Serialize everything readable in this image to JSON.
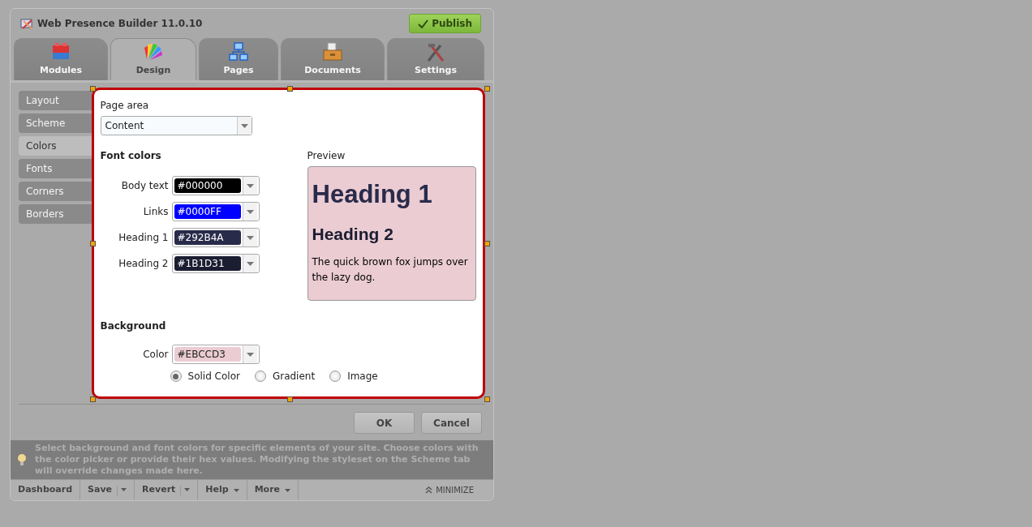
{
  "window": {
    "title": "Web Presence Builder 11.0.10",
    "publish_button": "Publish"
  },
  "tabs": [
    {
      "label": "Modules",
      "selected": false,
      "kind": "modules"
    },
    {
      "label": "Design",
      "selected": true,
      "kind": "design"
    },
    {
      "label": "Pages",
      "selected": false,
      "kind": "pages"
    },
    {
      "label": "Documents",
      "selected": false,
      "kind": "documents"
    },
    {
      "label": "Settings",
      "selected": false,
      "kind": "settings"
    }
  ],
  "sidebar": {
    "items": [
      {
        "label": "Layout",
        "selected": false
      },
      {
        "label": "Scheme",
        "selected": false
      },
      {
        "label": "Colors",
        "selected": true
      },
      {
        "label": "Fonts",
        "selected": false
      },
      {
        "label": "Corners",
        "selected": false
      },
      {
        "label": "Borders",
        "selected": false
      }
    ]
  },
  "dialog": {
    "page_area": {
      "label": "Page area",
      "value": "Content"
    },
    "font_colors": {
      "heading": "Font colors",
      "fields": [
        {
          "label": "Body text",
          "value": "#000000",
          "color": "#000000"
        },
        {
          "label": "Links",
          "value": "#0000FF",
          "color": "#0000ff"
        },
        {
          "label": "Heading 1",
          "value": "#292B4A",
          "color": "#292b4a"
        },
        {
          "label": "Heading 2",
          "value": "#1B1D31",
          "color": "#1b1d31"
        }
      ]
    },
    "preview": {
      "label": "Preview",
      "heading_1": "Heading 1",
      "heading_2": "Heading 2",
      "body": "The quick brown fox jumps over the lazy dog."
    },
    "background": {
      "heading": "Background",
      "field": {
        "label": "Color",
        "value": "#EBCCD3",
        "color": "#ebccd3"
      },
      "options": [
        {
          "label": "Solid Color",
          "selected": true
        },
        {
          "label": "Gradient",
          "selected": false
        },
        {
          "label": "Image",
          "selected": false
        }
      ]
    }
  },
  "buttons": [
    "OK",
    "Cancel"
  ],
  "hint": "Select background and font colors for specific elements of your site. Choose colors with the color picker or provide their hex values. Modifying the styleset on the Scheme tab will override changes made here.",
  "bottom_bar": {
    "items": [
      {
        "label": "Dashboard",
        "kind": "plain"
      },
      {
        "label": "Save",
        "kind": "split"
      },
      {
        "label": "Revert",
        "kind": "split"
      },
      {
        "label": "Help",
        "kind": "menu"
      },
      {
        "label": "More",
        "kind": "menu"
      }
    ],
    "minimize": "MINIMIZE"
  }
}
